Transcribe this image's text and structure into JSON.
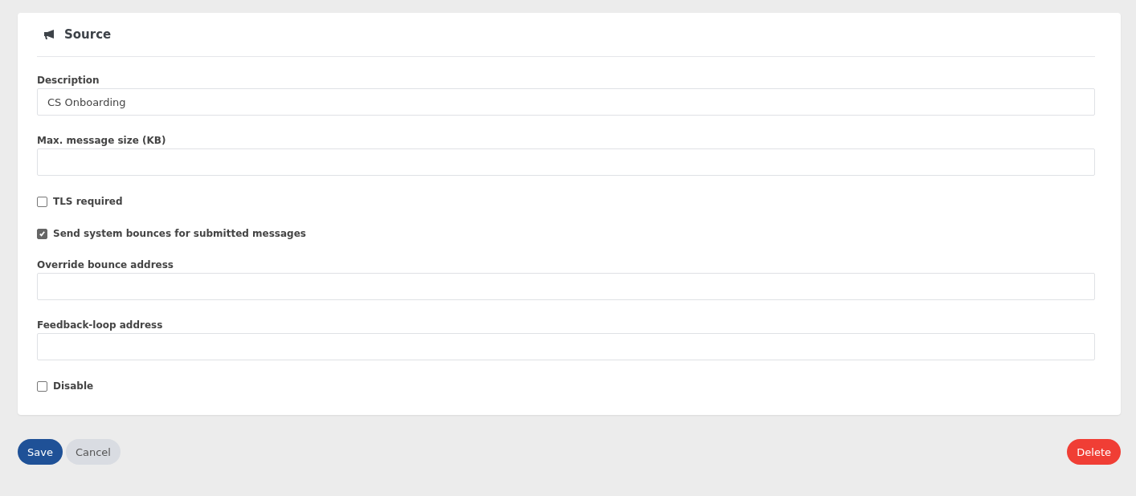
{
  "card": {
    "title": "Source"
  },
  "fields": [
    {
      "kind": "text",
      "label": "Description",
      "value": "CS Onboarding"
    },
    {
      "kind": "text",
      "label": "Max. message size (KB)"
    },
    {
      "kind": "checkbox",
      "label": "TLS required",
      "checked": false
    },
    {
      "kind": "checkbox",
      "label": "Send system bounces for submitted messages",
      "checked": true
    },
    {
      "kind": "text",
      "label": "Override bounce address"
    },
    {
      "kind": "text",
      "label": "Feedback-loop address"
    },
    {
      "kind": "checkbox",
      "label": "Disable",
      "checked": false
    }
  ],
  "buttons": [
    {
      "kind": "primary",
      "label": "Save"
    },
    {
      "kind": "secondary",
      "label": "Cancel"
    },
    {
      "kind": "danger",
      "label": "Delete"
    }
  ]
}
